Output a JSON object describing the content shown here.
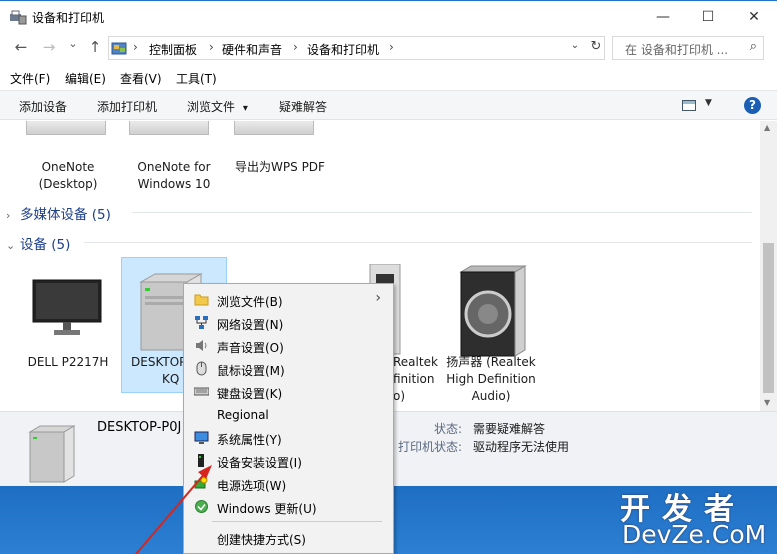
{
  "window": {
    "title": "设备和打印机",
    "minimize_glyph": "—",
    "maximize_glyph": "☐",
    "close_glyph": "✕"
  },
  "nav": {
    "back_glyph": "←",
    "forward_glyph": "→",
    "recent_glyph": "⌄",
    "up_glyph": "↑",
    "breadcrumbs": [
      "控制面板",
      "硬件和声音",
      "设备和打印机"
    ],
    "crumb_sep": "›",
    "dropdown_glyph": "⌄",
    "refresh_glyph": "↻",
    "search_placeholder": "在 设备和打印机 ...",
    "search_glyph": "⌕"
  },
  "menubar": [
    "文件(F)",
    "编辑(E)",
    "查看(V)",
    "工具(T)"
  ],
  "commandbar": {
    "items": [
      "添加设备",
      "添加打印机",
      "浏览文件",
      "疑难解答"
    ],
    "dropdown_glyph": "▾",
    "view_dropdown_glyph": "▼",
    "help_label": "?"
  },
  "printers": [
    {
      "label_line1": "OneNote",
      "label_line2": "(Desktop)"
    },
    {
      "label_line1": "OneNote for",
      "label_line2": "Windows 10"
    },
    {
      "label_line1": "导出为WPS PDF",
      "label_line2": ""
    }
  ],
  "groups": {
    "multimedia": {
      "chevron": "›",
      "label": "多媒体设备 (5)"
    },
    "devices": {
      "chevron": "⌄",
      "label": "设备 (5)"
    }
  },
  "devices": [
    {
      "label_line1": "DELL P2217H",
      "label_line2": "",
      "label_line3": ""
    },
    {
      "label_line1": "DESKTOP-P0",
      "label_line2": "KQ",
      "label_line3": ""
    },
    {
      "label_line1": "Realtek",
      "label_line2": "finition",
      "label_line3": "o)"
    },
    {
      "label_line1": "扬声器 (Realtek",
      "label_line2": "High Definition",
      "label_line3": "Audio)"
    }
  ],
  "details": {
    "name": "DESKTOP-P0J",
    "status_key": "状态:",
    "status_value": "需要疑难解答",
    "printer_status_key": "打印机状态:",
    "printer_status_value": "驱动程序无法使用"
  },
  "context_menu": {
    "submenu_glyph": "›",
    "items": [
      {
        "label": "浏览文件(B)",
        "icon": "folder-icon"
      },
      {
        "label": "网络设置(N)",
        "icon": "network-icon"
      },
      {
        "label": "声音设置(O)",
        "icon": "speaker-icon"
      },
      {
        "label": "鼠标设置(M)",
        "icon": "mouse-icon"
      },
      {
        "label": "键盘设置(K)",
        "icon": "keyboard-icon"
      },
      {
        "label": "Regional",
        "icon": ""
      },
      {
        "label": "系统属性(Y)",
        "icon": "monitor-icon"
      },
      {
        "label": "设备安装设置(I)",
        "icon": "device-install-icon"
      },
      {
        "label": "电源选项(W)",
        "icon": "power-icon"
      },
      {
        "label": "Windows 更新(U)",
        "icon": "windows-update-icon"
      },
      {
        "label": "创建快捷方式(S)",
        "icon": ""
      }
    ]
  },
  "watermark": {
    "line1": "开发者",
    "line2": "DevZe.CoM"
  },
  "colors": {
    "accent": "#1e73c8",
    "selection": "#cce8ff",
    "link": "#1e3f8a",
    "annotation": "#d7261e"
  }
}
